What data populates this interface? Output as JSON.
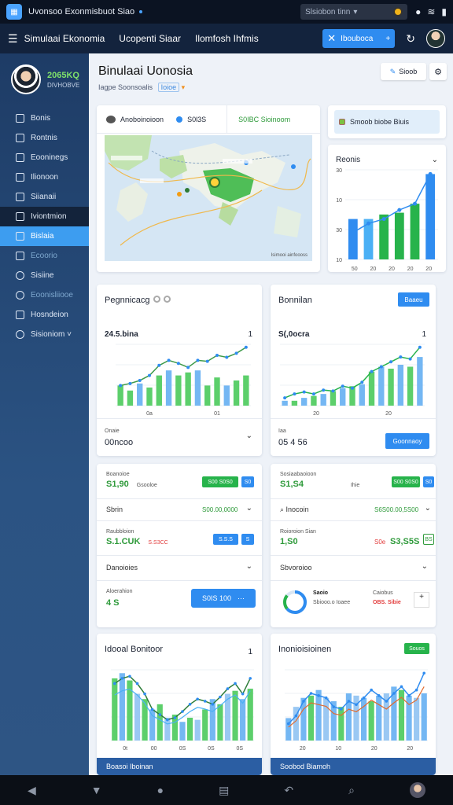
{
  "status": {
    "app_title": "Uvonsoo Exonmisbuot Siao",
    "search_placeholder": "Slsiobon tinn",
    "icons": [
      "notification-icon",
      "wifi-icon",
      "battery-icon"
    ]
  },
  "topbar": {
    "tabs": [
      "Simulaai Ekonomia",
      "Ucopenti Siaar",
      "Ilomfosh Ihfmis"
    ],
    "action_label": "Ibouboca",
    "action_plus": "+"
  },
  "sidebar": {
    "profile_number": "2065KQ",
    "profile_sub": "DIVHOBVE",
    "items": [
      {
        "label": "Bonis",
        "icon": "home-icon",
        "state": "normal"
      },
      {
        "label": "Rontnis",
        "icon": "check-icon",
        "state": "normal"
      },
      {
        "label": "Eooninegs",
        "icon": "document-icon",
        "state": "normal"
      },
      {
        "label": "Ilionoon",
        "icon": "list-icon",
        "state": "normal"
      },
      {
        "label": "Siianaii",
        "icon": "chart-icon",
        "state": "normal"
      },
      {
        "label": "Iviontmion",
        "icon": "portfolio-icon",
        "state": "dark"
      },
      {
        "label": "Bislaia",
        "icon": "grid-icon",
        "state": "active"
      },
      {
        "label": "Ecoorio",
        "icon": "settings-icon",
        "state": "faded"
      },
      {
        "label": "Sisiine",
        "icon": "globe-icon",
        "state": "normal"
      },
      {
        "label": "Eoonisliiooe",
        "icon": "clock-icon",
        "state": "faded"
      },
      {
        "label": "Hosndeion",
        "icon": "report-icon",
        "state": "normal"
      },
      {
        "label": "Sisioniom ˅",
        "icon": "support-icon",
        "state": "normal"
      }
    ]
  },
  "main": {
    "title": "Binulaai Uonosia",
    "subtitle": "Iagpe Soonsoalis",
    "subtitle_tag": "Ioioe",
    "search_btn": "Sioob",
    "map_card": {
      "head1": "Anoboinoioon",
      "head2": "S0l3S",
      "head3": "S0IBC Sioinoom",
      "credit": "Isimooi ainfoooss"
    },
    "right_top": {
      "label": "Smoob biobe Biuis"
    },
    "bars_card": {
      "title": "Reonis",
      "y_ticks": [
        "30",
        "10",
        "30",
        "10"
      ],
      "x_ticks": [
        "50",
        "20",
        "20",
        "20",
        "20"
      ]
    },
    "left_chart": {
      "title": "Pegnnicacg",
      "value": "24.5.bina",
      "value_right": "1",
      "foot_label": "Onaie",
      "foot_value": "00ncoo",
      "x_ticks": [
        "0a",
        "01"
      ]
    },
    "right_chart": {
      "title": "Bonnilan",
      "button": "Baaeu",
      "value": "S(,0ocra",
      "value_right": "1",
      "foot_label": "Iaa",
      "foot_value": "05 4 56",
      "foot_button": "Goonnaoy",
      "x_ticks": [
        "20",
        "20"
      ]
    },
    "left_table": {
      "r1_label": "Boanoioe",
      "r1_value": "S1,90",
      "r1_small": "Gsooloe",
      "r1_tag": "S00 S0S0",
      "r1_tag2": "S0",
      "r2_label": "Sbrin",
      "r2_value": "S00.00,0000",
      "r3_label": "Raubbloion",
      "r3_value": "S.1.CUK",
      "r3_red": "S.S3CC",
      "r3_tag": "S.S.S",
      "r3_tag2": "S",
      "r4_label": "Danoioies",
      "r5_label": "Aloerahion",
      "r5_value": "4 S",
      "r5_button": "S0IS 100"
    },
    "right_table": {
      "r1_label": "Sosiaabaoioon",
      "r1_value": "S1,S4",
      "r1_small": "Ihie",
      "r1_tag": "S00 S0S0",
      "r1_tag2": "S0",
      "r2_label": "Inocoin",
      "r2_value": "S6S00.00,5S00",
      "r3_label": "Roioroion Sian",
      "r3_value": "1,S0",
      "r3_red": "S0e",
      "r3_value2": "S3,S5S",
      "r3_tag": "BS",
      "r4_label": "Sbvoroioo",
      "r5_label1": "Saoio",
      "r5_value1": "Sbiooo.o Ioaee",
      "r5_label2": "Caiobus",
      "r5_value2": "OBS. Sibie"
    },
    "bottom_left": {
      "title": "Idooal Bonitoor",
      "value_right": "1",
      "strip": "Boasoi Iboinan",
      "x_ticks": [
        "0t",
        "00",
        "0S",
        "0S",
        "0S"
      ]
    },
    "bottom_right": {
      "title": "Inonioisioinen",
      "badge": "Souos",
      "strip": "Soobod Biamoh",
      "x_ticks": [
        "20",
        "10",
        "20",
        "20"
      ]
    }
  },
  "chart_data": [
    {
      "type": "bar",
      "title": "Reonis",
      "categories": [
        "1",
        "2",
        "3",
        "4",
        "5",
        "6"
      ],
      "series": [
        {
          "values": [
            45,
            45,
            50,
            52,
            62,
            95
          ]
        }
      ],
      "line": [
        30,
        40,
        45,
        55,
        62,
        95
      ]
    },
    {
      "type": "bar",
      "title": "Pegnnicacg",
      "categories": [
        "1",
        "2",
        "3",
        "4",
        "5",
        "6",
        "7",
        "8",
        "9",
        "10",
        "11",
        "12",
        "13",
        "14"
      ],
      "series": [
        {
          "values": [
            20,
            15,
            22,
            18,
            30,
            35,
            30,
            33,
            35,
            20,
            28,
            20,
            25,
            30
          ]
        }
      ],
      "line": [
        20,
        22,
        25,
        30,
        40,
        45,
        42,
        38,
        45,
        44,
        50,
        48,
        52,
        58
      ]
    },
    {
      "type": "bar",
      "title": "Bonnilan",
      "categories": [
        "1",
        "2",
        "3",
        "4",
        "5",
        "6",
        "7",
        "8",
        "9",
        "10",
        "11",
        "12",
        "13",
        "14",
        "15"
      ],
      "series": [
        {
          "values": [
            5,
            5,
            8,
            10,
            12,
            15,
            18,
            20,
            22,
            35,
            40,
            38,
            42,
            40,
            50
          ]
        }
      ],
      "line": [
        8,
        12,
        14,
        12,
        16,
        15,
        20,
        18,
        24,
        35,
        40,
        45,
        50,
        48,
        60
      ]
    },
    {
      "type": "bar",
      "title": "Idooal Bonitoor",
      "categories": [
        "1",
        "2",
        "3",
        "4",
        "5",
        "6",
        "7",
        "8",
        "9",
        "10",
        "11",
        "12",
        "13",
        "14",
        "15",
        "16",
        "17",
        "18",
        "19"
      ],
      "series": [
        {
          "values": [
            60,
            65,
            58,
            45,
            40,
            30,
            35,
            22,
            25,
            18,
            22,
            20,
            30,
            40,
            35,
            45,
            48,
            40,
            50
          ]
        }
      ],
      "line": [
        55,
        60,
        62,
        55,
        45,
        30,
        25,
        20,
        22,
        28,
        35,
        40,
        38,
        35,
        42,
        50,
        55,
        45,
        60
      ]
    },
    {
      "type": "bar",
      "title": "Inonioisioinen",
      "categories": [
        "1",
        "2",
        "3",
        "4",
        "5",
        "6",
        "7",
        "8",
        "9",
        "10",
        "11",
        "12",
        "13",
        "14",
        "15",
        "16",
        "17",
        "18",
        "19"
      ],
      "series": [
        {
          "values": [
            20,
            30,
            38,
            40,
            45,
            38,
            35,
            30,
            42,
            40,
            38,
            35,
            40,
            42,
            48,
            45,
            40,
            38,
            42
          ]
        }
      ],
      "line": [
        15,
        22,
        35,
        42,
        40,
        38,
        30,
        28,
        35,
        32,
        38,
        45,
        40,
        35,
        42,
        48,
        40,
        45,
        60
      ]
    }
  ]
}
